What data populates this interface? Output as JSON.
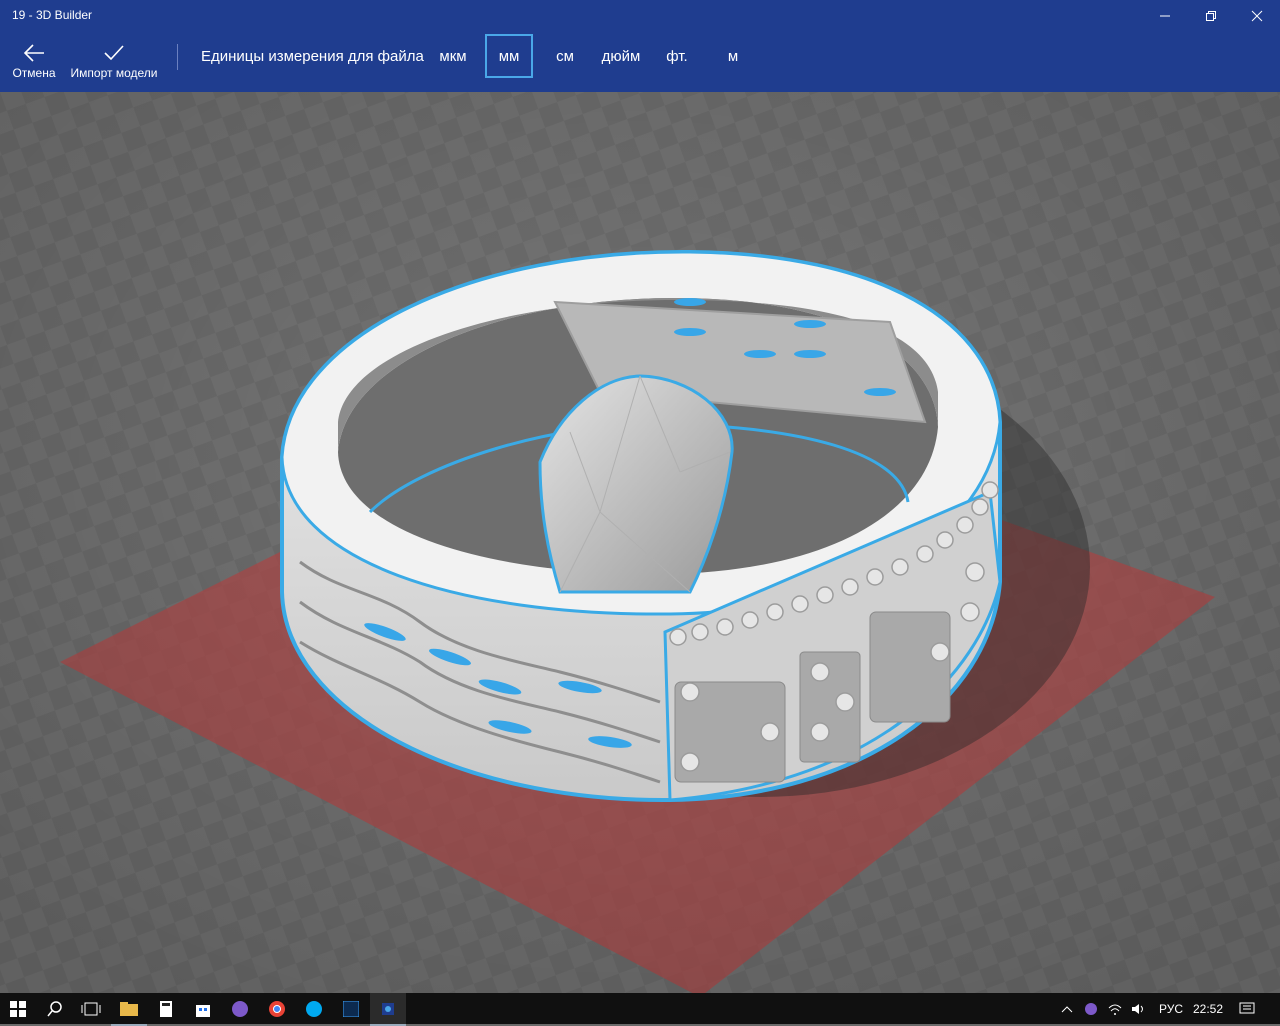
{
  "window": {
    "title": "19 - 3D Builder"
  },
  "toolbar": {
    "cancel_label": "Отмена",
    "import_label": "Импорт модели",
    "units_label": "Единицы измерения для файла",
    "units": [
      "мкм",
      "мм",
      "см",
      "дюйм",
      "фт.",
      "м"
    ],
    "selected_unit": "мм"
  },
  "colors": {
    "accent": "#1f3d8f",
    "selection": "#4aa8e8",
    "plate": "#b94a4a"
  },
  "taskbar": {
    "pinned_icons": [
      "start-icon",
      "search-icon",
      "task-view-icon",
      "file-explorer-icon",
      "calculator-icon",
      "store-icon",
      "viber-icon",
      "chrome-icon",
      "skype-icon",
      "photoshop-icon",
      "3d-builder-icon"
    ],
    "language": "РУС",
    "time": "22:52"
  }
}
